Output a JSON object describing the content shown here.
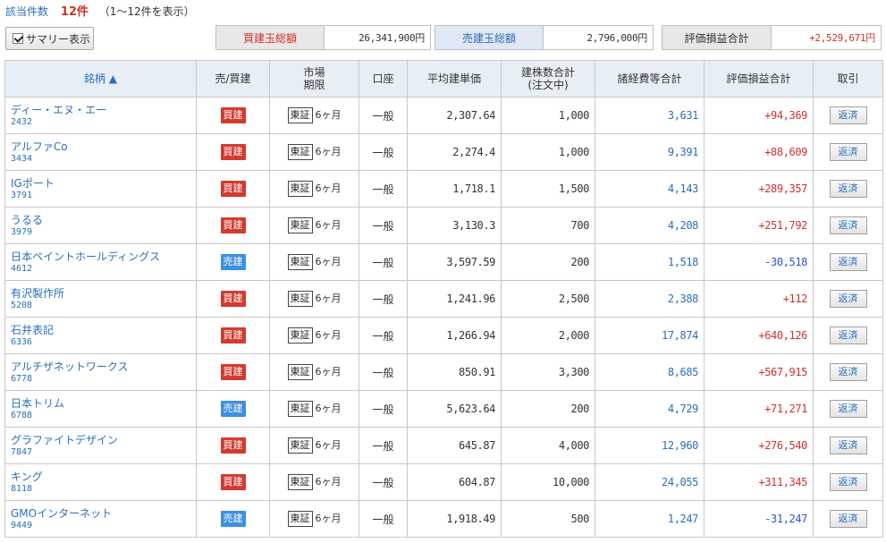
{
  "header": {
    "count_label": "該当件数",
    "count_value": "12件",
    "count_range": "（1～12件を表示）"
  },
  "summary_toggle": {
    "label": "サマリー表示",
    "checked": true
  },
  "summary": {
    "buy_label": "買建玉総額",
    "buy_value": "26,341,900円",
    "sell_label": "売建玉総額",
    "sell_value": "2,796,000円",
    "pl_label": "評価損益合計",
    "pl_value": "+2,529,671円"
  },
  "columns": {
    "name": "銘柄 ▲",
    "side": "売/買建",
    "market_line1": "市場",
    "market_line2": "期限",
    "account": "口座",
    "avg_price": "平均建単価",
    "qty_line1": "建株数合計",
    "qty_line2": "(注文中)",
    "fees": "諸経費等合計",
    "pl": "評価損益合計",
    "trade": "取引"
  },
  "rows": [
    {
      "name": "ディー・エヌ・エー",
      "code": "2432",
      "side": "買建",
      "side_type": "buy",
      "market": "東証",
      "term": "6ヶ月",
      "account": "一般",
      "avg": "2,307.64",
      "qty": "1,000",
      "fees": "3,631",
      "pl": "+94,369",
      "pl_sign": "pos",
      "action": "返済"
    },
    {
      "name": "アルファCo",
      "code": "3434",
      "side": "買建",
      "side_type": "buy",
      "market": "東証",
      "term": "6ヶ月",
      "account": "一般",
      "avg": "2,274.4",
      "qty": "1,000",
      "fees": "9,391",
      "pl": "+88,609",
      "pl_sign": "pos",
      "action": "返済"
    },
    {
      "name": "IGポート",
      "code": "3791",
      "side": "買建",
      "side_type": "buy",
      "market": "東証",
      "term": "6ヶ月",
      "account": "一般",
      "avg": "1,718.1",
      "qty": "1,500",
      "fees": "4,143",
      "pl": "+289,357",
      "pl_sign": "pos",
      "action": "返済"
    },
    {
      "name": "うるる",
      "code": "3979",
      "side": "買建",
      "side_type": "buy",
      "market": "東証",
      "term": "6ヶ月",
      "account": "一般",
      "avg": "3,130.3",
      "qty": "700",
      "fees": "4,208",
      "pl": "+251,792",
      "pl_sign": "pos",
      "action": "返済"
    },
    {
      "name": "日本ペイントホールディングス",
      "code": "4612",
      "side": "売建",
      "side_type": "sell",
      "market": "東証",
      "term": "6ヶ月",
      "account": "一般",
      "avg": "3,597.59",
      "qty": "200",
      "fees": "1,518",
      "pl": "-30,518",
      "pl_sign": "neg",
      "action": "返済"
    },
    {
      "name": "有沢製作所",
      "code": "5208",
      "side": "買建",
      "side_type": "buy",
      "market": "東証",
      "term": "6ヶ月",
      "account": "一般",
      "avg": "1,241.96",
      "qty": "2,500",
      "fees": "2,388",
      "pl": "+112",
      "pl_sign": "pos",
      "action": "返済"
    },
    {
      "name": "石井表記",
      "code": "6336",
      "side": "買建",
      "side_type": "buy",
      "market": "東証",
      "term": "6ヶ月",
      "account": "一般",
      "avg": "1,266.94",
      "qty": "2,000",
      "fees": "17,874",
      "pl": "+640,126",
      "pl_sign": "pos",
      "action": "返済"
    },
    {
      "name": "アルチザネットワークス",
      "code": "6778",
      "side": "買建",
      "side_type": "buy",
      "market": "東証",
      "term": "6ヶ月",
      "account": "一般",
      "avg": "850.91",
      "qty": "3,300",
      "fees": "8,685",
      "pl": "+567,915",
      "pl_sign": "pos",
      "action": "返済"
    },
    {
      "name": "日本トリム",
      "code": "6788",
      "side": "売建",
      "side_type": "sell",
      "market": "東証",
      "term": "6ヶ月",
      "account": "一般",
      "avg": "5,623.64",
      "qty": "200",
      "fees": "4,729",
      "pl": "+71,271",
      "pl_sign": "pos",
      "action": "返済"
    },
    {
      "name": "グラファイトデザイン",
      "code": "7847",
      "side": "買建",
      "side_type": "buy",
      "market": "東証",
      "term": "6ヶ月",
      "account": "一般",
      "avg": "645.87",
      "qty": "4,000",
      "fees": "12,960",
      "pl": "+276,540",
      "pl_sign": "pos",
      "action": "返済"
    },
    {
      "name": "キング",
      "code": "8118",
      "side": "買建",
      "side_type": "buy",
      "market": "東証",
      "term": "6ヶ月",
      "account": "一般",
      "avg": "604.87",
      "qty": "10,000",
      "fees": "24,055",
      "pl": "+311,345",
      "pl_sign": "pos",
      "action": "返済"
    },
    {
      "name": "GMOインターネット",
      "code": "9449",
      "side": "売建",
      "side_type": "sell",
      "market": "東証",
      "term": "6ヶ月",
      "account": "一般",
      "avg": "1,918.49",
      "qty": "500",
      "fees": "1,247",
      "pl": "-31,247",
      "pl_sign": "neg",
      "action": "返済"
    }
  ],
  "colors": {
    "buy": "#d33a30",
    "sell": "#3d8fe0",
    "link": "#2a6ebb",
    "positive": "#d1302b",
    "negative": "#2a55c9"
  }
}
